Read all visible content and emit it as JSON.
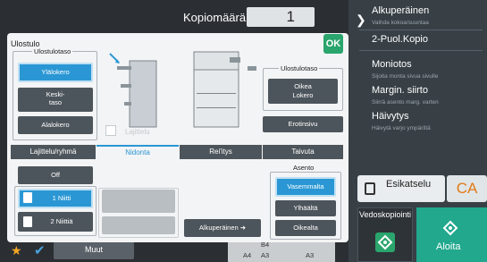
{
  "top": {
    "copies_label": "Kopiomäärä",
    "copies_value": "1"
  },
  "right_panel": {
    "items": [
      {
        "title": "Alkuperäinen",
        "sub": "Vaihda kokoa/suuntaa"
      },
      {
        "title": "2-Puol.Kopio",
        "sub": ""
      },
      {
        "title": "Moniotos",
        "sub": "Sijoita monta sivua sivulle"
      },
      {
        "title": "Margin. siirto",
        "sub": "Siirrä asento marg. varten"
      },
      {
        "title": "Häivytys",
        "sub": "Häivytä varjo ympäriltä"
      }
    ],
    "preview_label": "Esikatselu",
    "ca_label": "CA",
    "proof_label": "Vedoskopiointi",
    "start_label": "Aloita"
  },
  "bottom": {
    "muut_label": "Muut",
    "paper": [
      "B4",
      "A4",
      "A3",
      "A3"
    ]
  },
  "dialog": {
    "title": "Ulostulo",
    "ok_label": "OK",
    "output_tray_group": "Ulostulotaso",
    "tray_options": [
      "Ylälokero",
      "Keski-\ntaso",
      "Alalokero"
    ],
    "tray_selected": "Ylälokero",
    "right_group": "Ulostulotaso",
    "right_tray_option": "Oikea\nLokero",
    "separator_label": "Erotinsivu",
    "sort_checkbox_label": "Lajittelu",
    "tabs": [
      "Lajittelu/ryhmä",
      "Nidonta",
      "Rei'itys",
      "Taivuta"
    ],
    "active_tab": "Nidonta",
    "staple_options": [
      "Off",
      "1 Niitti",
      "2 Niittiä"
    ],
    "staple_selected": "1 Niitti",
    "position_label": "Asento",
    "position_options": [
      "Vasemmalta",
      "Ylhäältä",
      "Oikealta"
    ],
    "position_selected": "Vasemmalta",
    "original_button": "Alkuperäinen"
  }
}
